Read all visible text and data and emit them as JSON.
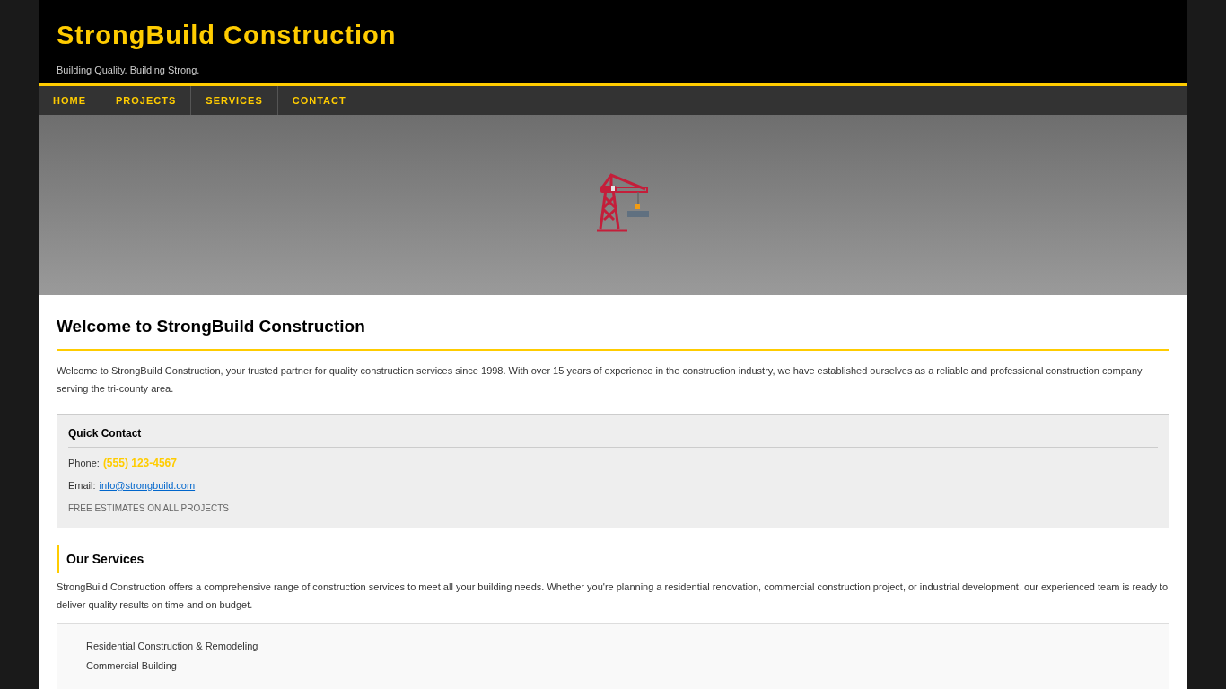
{
  "header": {
    "title": "StrongBuild Construction",
    "tagline": "Building Quality. Building Strong."
  },
  "nav": [
    {
      "label": "HOME"
    },
    {
      "label": "PROJECTS"
    },
    {
      "label": "SERVICES"
    },
    {
      "label": "CONTACT"
    }
  ],
  "welcome": {
    "heading": "Welcome to StrongBuild Construction",
    "text": "Welcome to StrongBuild Construction, your trusted partner for quality construction services since 1998. With over 15 years of experience in the construction industry, we have established ourselves as a reliable and professional construction company serving the tri-county area."
  },
  "quick_contact": {
    "heading": "Quick Contact",
    "phone_label": "Phone:",
    "phone": "(555) 123-4567",
    "email_label": "Email:",
    "email": "info@strongbuild.com",
    "note": "FREE ESTIMATES ON ALL PROJECTS"
  },
  "services": {
    "heading": "Our Services",
    "text": "StrongBuild Construction offers a comprehensive range of construction services to meet all your building needs. Whether you're planning a residential renovation, commercial construction project, or industrial development, our experienced team is ready to deliver quality results on time and on budget.",
    "items": [
      "Residential Construction & Remodeling",
      "Commercial Building"
    ]
  }
}
